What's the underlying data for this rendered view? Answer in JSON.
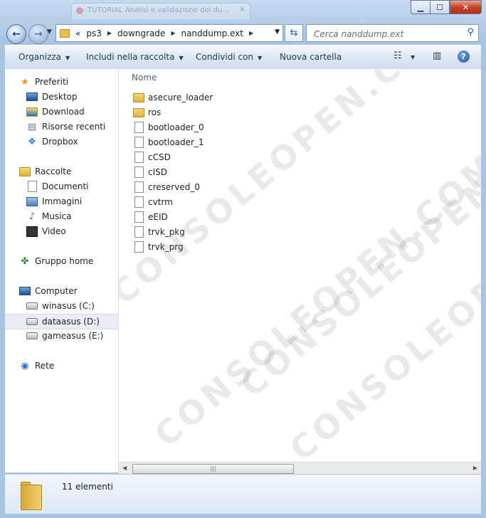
{
  "titlebar": {
    "background_tab_title": "TUTORIAL Analisi e validazione dei du..."
  },
  "address": {
    "overflow": "«",
    "crumbs": [
      "ps3",
      "downgrade",
      "nanddump.ext"
    ]
  },
  "search": {
    "placeholder": "Cerca nanddump.ext"
  },
  "commands": {
    "organize": "Organizza",
    "include": "Includi nella raccolta",
    "share": "Condividi con",
    "new_folder": "Nuova cartella"
  },
  "nav": {
    "favorites": "Preferiti",
    "desktop": "Desktop",
    "download": "Download",
    "recent": "Risorse recenti",
    "dropbox": "Dropbox",
    "libraries": "Raccolte",
    "documents": "Documenti",
    "pictures": "Immagini",
    "music": "Musica",
    "video": "Video",
    "homegroup": "Gruppo home",
    "computer": "Computer",
    "drive_c": "winasus (C:)",
    "drive_d": "dataasus (D:)",
    "drive_e": "gameasus (E:)",
    "network": "Rete"
  },
  "files": {
    "column_name": "Nome",
    "items": [
      {
        "name": "asecure_loader",
        "type": "folder"
      },
      {
        "name": "ros",
        "type": "folder"
      },
      {
        "name": "bootloader_0",
        "type": "file"
      },
      {
        "name": "bootloader_1",
        "type": "file"
      },
      {
        "name": "cCSD",
        "type": "file"
      },
      {
        "name": "cISD",
        "type": "file"
      },
      {
        "name": "creserved_0",
        "type": "file"
      },
      {
        "name": "cvtrm",
        "type": "file"
      },
      {
        "name": "eEID",
        "type": "file"
      },
      {
        "name": "trvk_pkg",
        "type": "file"
      },
      {
        "name": "trvk_prg",
        "type": "file"
      }
    ]
  },
  "watermark": "CONSOLEOPEN.COM",
  "details": {
    "count": "11 elementi"
  }
}
